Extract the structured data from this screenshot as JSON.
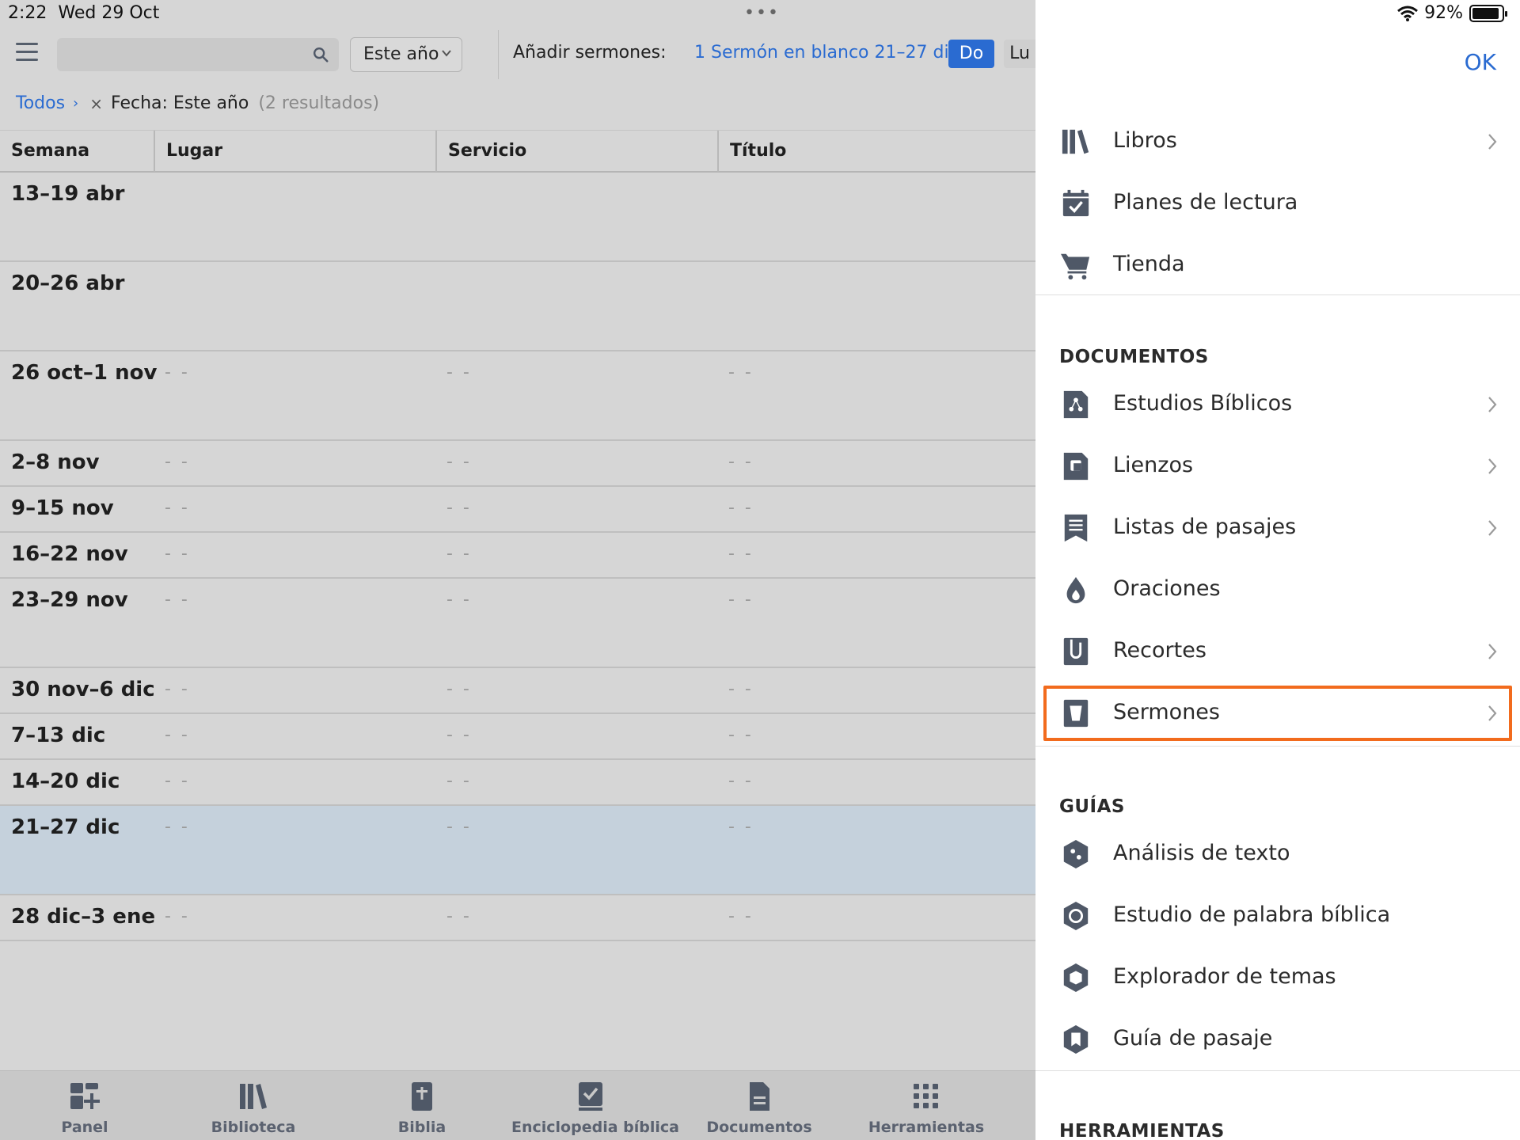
{
  "status": {
    "time": "2:22",
    "date": "Wed 29 Oct",
    "battery": "92%",
    "battery_level": 0.92
  },
  "toolbar": {
    "search_placeholder": "",
    "filter_value": "Este año",
    "add_label": "Añadir sermones:",
    "add_link": "1 Sermón en blanco 21–27 dic",
    "day_active": "Do",
    "day_next": "Lu"
  },
  "breadcrumb": {
    "all": "Todos",
    "filter": "Fecha: Este año",
    "count": "(2 resultados)"
  },
  "table": {
    "headers": [
      "Semana",
      "Lugar",
      "Servicio",
      "Título"
    ],
    "placeholder": "- -",
    "rows": [
      {
        "week": "13–19 abr",
        "empty": false,
        "tall": true
      },
      {
        "week": "20–26 abr",
        "empty": false,
        "tall": true
      },
      {
        "week": "26 oct–1 nov",
        "empty": true,
        "tall": true
      },
      {
        "week": "2–8 nov",
        "empty": true,
        "tall": false
      },
      {
        "week": "9–15 nov",
        "empty": true,
        "tall": false
      },
      {
        "week": "16–22 nov",
        "empty": true,
        "tall": false
      },
      {
        "week": "23–29 nov",
        "empty": true,
        "tall": true
      },
      {
        "week": "30 nov–6 dic",
        "empty": true,
        "tall": false
      },
      {
        "week": "7–13 dic",
        "empty": true,
        "tall": false
      },
      {
        "week": "14–20 dic",
        "empty": true,
        "tall": false
      },
      {
        "week": "21–27 dic",
        "empty": true,
        "tall": true,
        "selected": true
      },
      {
        "week": "28 dic–3 ene",
        "empty": true,
        "tall": false
      }
    ]
  },
  "tabbar": [
    "Panel",
    "Biblioteca",
    "Biblia",
    "Enciclopedia bíblica",
    "Documentos",
    "Herramientas"
  ],
  "menu": {
    "ok": "OK",
    "top_items": [
      {
        "label": "Libros",
        "icon": "books-icon",
        "chevron": true
      },
      {
        "label": "Planes de lectura",
        "icon": "calendar-check-icon",
        "chevron": false
      },
      {
        "label": "Tienda",
        "icon": "cart-icon",
        "chevron": false
      }
    ],
    "documents_title": "DOCUMENTOS",
    "documents": [
      {
        "label": "Estudios Bíblicos",
        "icon": "bible-study-icon",
        "chevron": true
      },
      {
        "label": "Lienzos",
        "icon": "canvas-icon",
        "chevron": true
      },
      {
        "label": "Listas de pasajes",
        "icon": "passage-list-icon",
        "chevron": true
      },
      {
        "label": "Oraciones",
        "icon": "prayer-flame-icon",
        "chevron": false
      },
      {
        "label": "Recortes",
        "icon": "clippings-icon",
        "chevron": true
      },
      {
        "label": "Sermones",
        "icon": "sermon-icon",
        "chevron": true,
        "highlighted": true
      }
    ],
    "guides_title": "GUÍAS",
    "guides": [
      {
        "label": "Análisis de texto",
        "icon": "text-analysis-icon"
      },
      {
        "label": "Estudio de palabra bíblica",
        "icon": "word-study-icon"
      },
      {
        "label": "Explorador de temas",
        "icon": "topic-explorer-icon"
      },
      {
        "label": "Guía de pasaje",
        "icon": "passage-guide-icon"
      }
    ],
    "tools_title": "HERRAMIENTAS"
  },
  "colors": {
    "accent": "#2a6bd1",
    "highlight": "#f26b1d",
    "icon": "#4f5867",
    "selected_row": "#c5d1dc"
  }
}
